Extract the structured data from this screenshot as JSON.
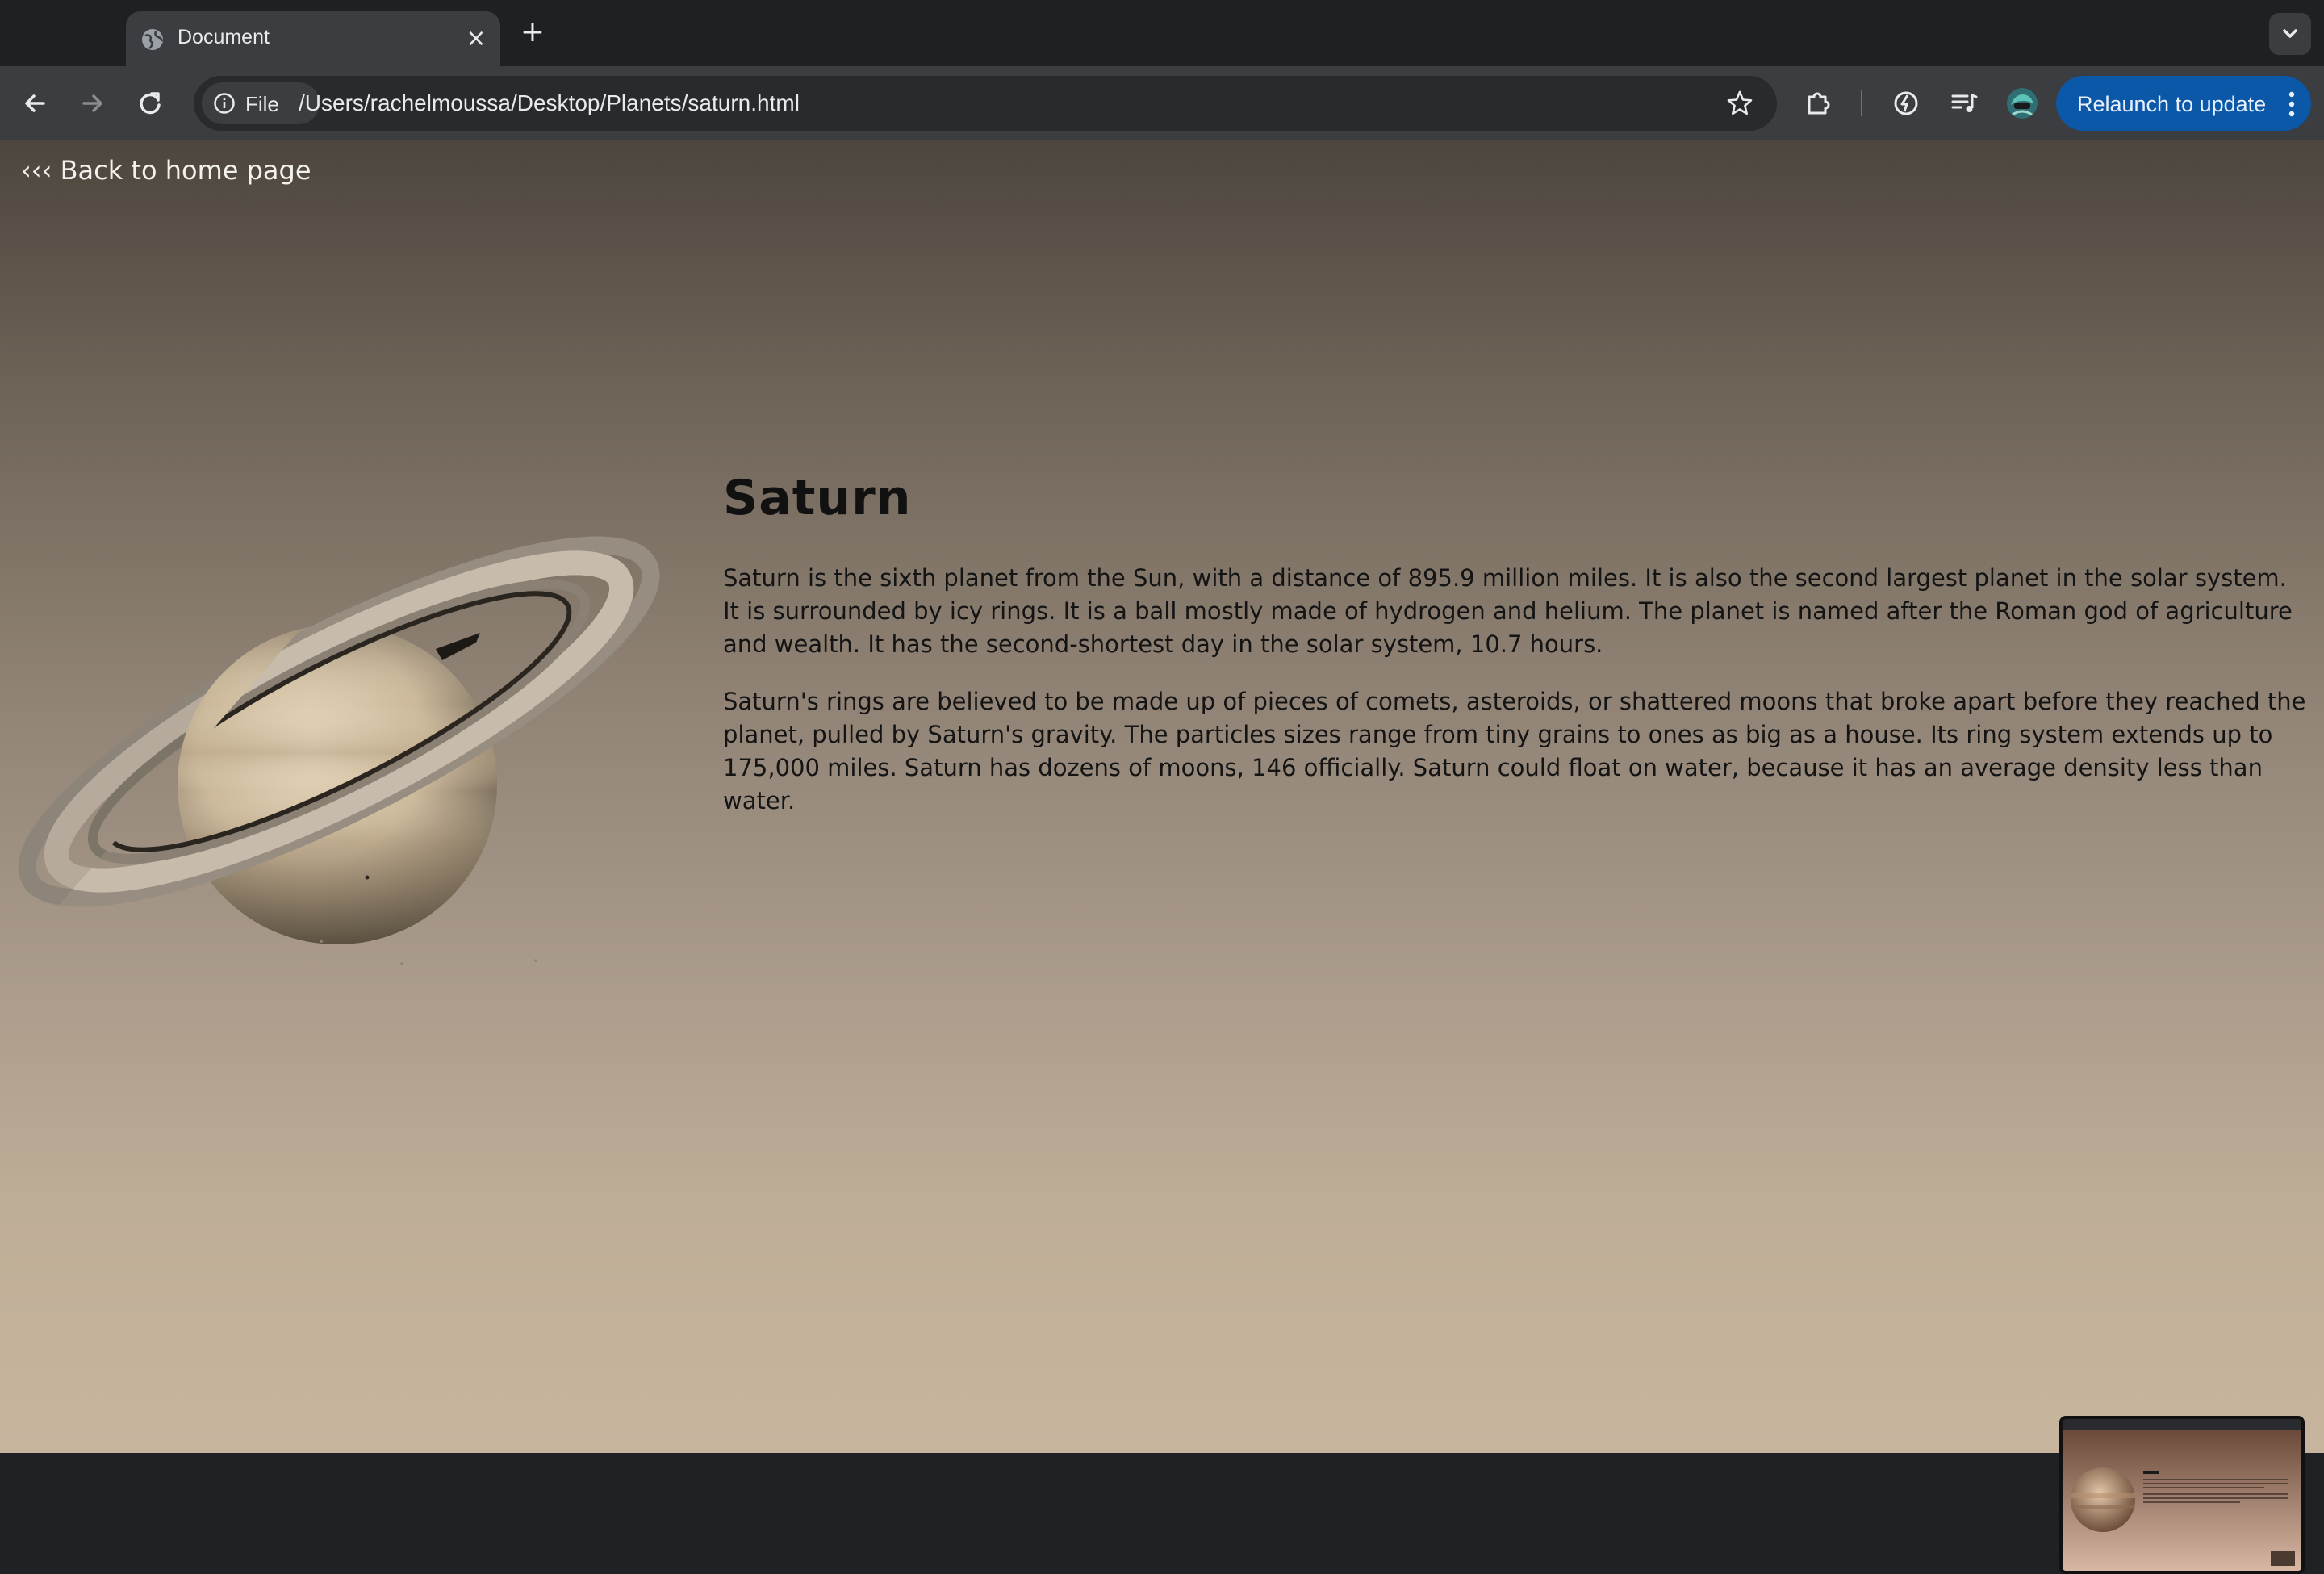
{
  "browser": {
    "tab_title": "Document",
    "new_tab_symbol": "+",
    "close_symbol": "×",
    "file_chip_label": "File",
    "url": "/Users/rachelmoussa/Desktop/Planets/saturn.html",
    "relaunch_label": "Relaunch to update",
    "icons": [
      "globe-icon",
      "close-icon",
      "plus-icon",
      "chevron-down-icon",
      "back-arrow-icon",
      "forward-arrow-icon",
      "reload-icon",
      "info-icon",
      "star-icon",
      "extensions-icon",
      "performance-icon",
      "media-queue-icon",
      "profile-avatar-icon",
      "more-vert-icon"
    ],
    "accent_color": "#0b57a8"
  },
  "page": {
    "back_link": "‹‹‹ Back to home page",
    "title": "Saturn",
    "paragraphs": [
      "Saturn is the sixth planet from the Sun, with a distance of 895.9 million miles. It is also the second largest planet in the solar system. It is surrounded by icy rings. It is a ball mostly made of hydrogen and helium. The planet is named after the Roman god of agriculture and wealth. It has the second-shortest day in the solar system, 10.7 hours.",
      "Saturn's rings are believed to be made up of pieces of comets, asteroids, or shattered moons that broke apart before they reached the planet, pulled by Saturn's gravity. The particles sizes range from tiny grains to ones as big as a house. Its ring system extends up to 175,000 miles. Saturn has dozens of moons, 146 officially. Saturn could float on water, because it has an average density less than water."
    ]
  }
}
